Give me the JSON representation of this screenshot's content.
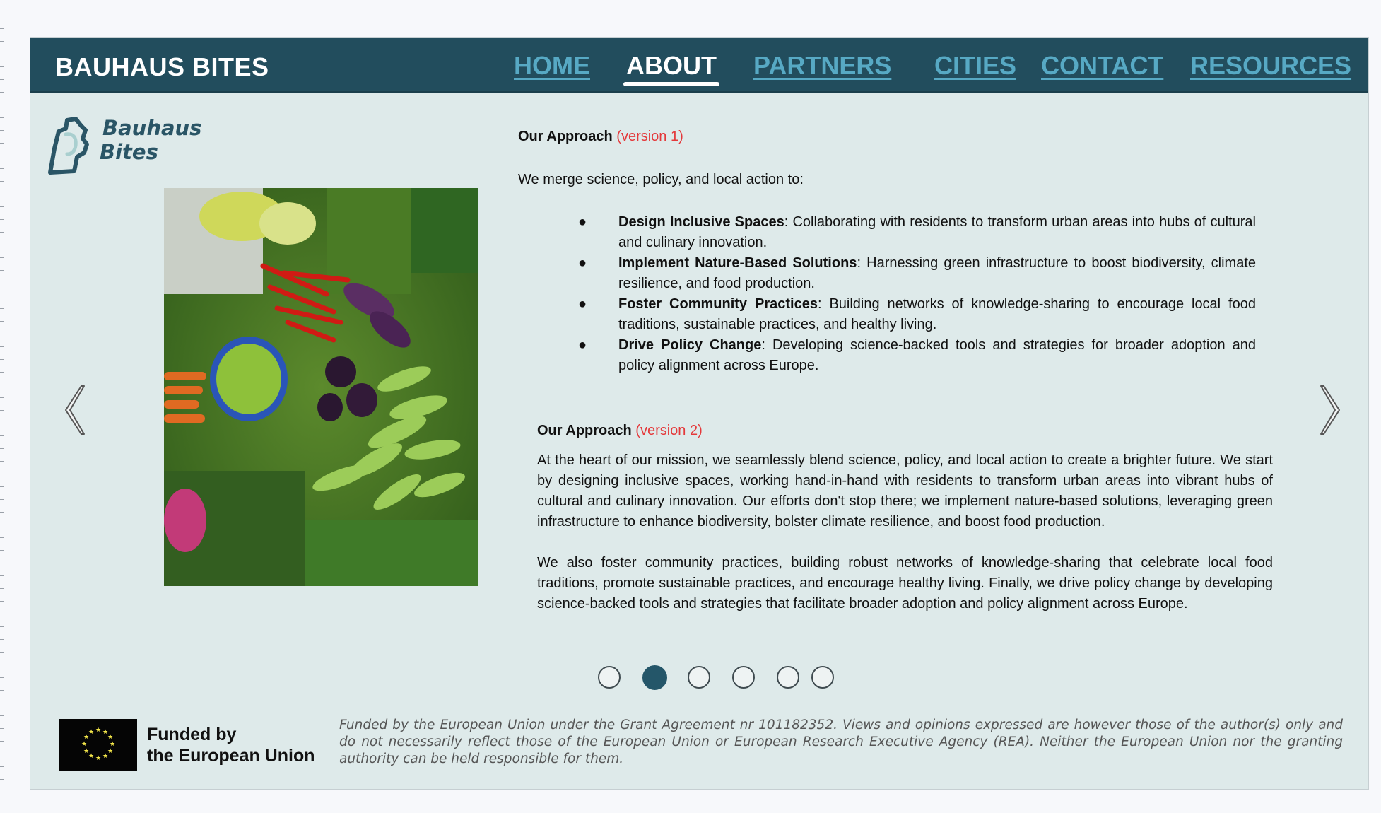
{
  "brand": "BAUHAUS BITES",
  "nav": [
    {
      "label": "HOME",
      "active": false
    },
    {
      "label": "ABOUT",
      "active": true
    },
    {
      "label": "PARTNERS",
      "active": false
    },
    {
      "label": "CITIES",
      "active": false
    },
    {
      "label": "CONTACT",
      "active": false
    },
    {
      "label": "RESOURCES",
      "active": false
    }
  ],
  "logo": {
    "line1": "Bauhaus",
    "line2": "Bites"
  },
  "version1": {
    "title": "Our Approach",
    "tag": "(version 1)",
    "intro": "We merge science, policy, and local action to:",
    "bullets": [
      {
        "bold": "Design Inclusive Spaces",
        "text": ": Collaborating with residents to transform urban areas into hubs of cultural and culinary innovation."
      },
      {
        "bold": "Implement Nature-Based Solutions",
        "text": ": Harnessing green infrastructure to boost biodiversity, climate resilience, and food production."
      },
      {
        "bold": "Foster Community Practices",
        "text": ": Building networks of knowledge-sharing to encourage local food traditions, sustainable practices, and healthy living."
      },
      {
        "bold": "Drive Policy Change",
        "text": ": Developing science-backed tools and strategies for broader adoption and policy alignment across Europe."
      }
    ]
  },
  "version2": {
    "title": "Our Approach",
    "tag": "(version 2)",
    "paragraphs": [
      "At the heart of our mission, we seamlessly blend science, policy, and local action to create a brighter future. We start by designing inclusive spaces, working hand-in-hand with residents to transform urban areas into vibrant hubs of cultural and culinary innovation. Our efforts don't stop there; we implement nature-based solutions, leveraging green infrastructure to enhance biodiversity, bolster climate resilience, and boost food production.",
      "We also foster community practices, building robust networks of knowledge-sharing that celebrate local food traditions, promote sustainable practices, and encourage healthy living. Finally, we drive policy change by developing science-backed tools and strategies that facilitate broader adoption and policy alignment across Europe."
    ]
  },
  "carousel": {
    "total": 6,
    "active_index": 1
  },
  "footer": {
    "funded_line1": "Funded by",
    "funded_line2": "the European Union",
    "disclaimer": "Funded by the European Union under the Grant Agreement nr 101182352. Views and opinions expressed are however those of the author(s) only and do not necessarily reflect those of the European Union or European Research Executive Agency (REA). Neither the European Union nor the granting authority can be held responsible for them."
  },
  "colors": {
    "header": "#224d5d",
    "nav_link": "#57a9c4",
    "version_tag": "#e4393b",
    "page_bg": "#deeaea",
    "active_dot": "#245669"
  }
}
